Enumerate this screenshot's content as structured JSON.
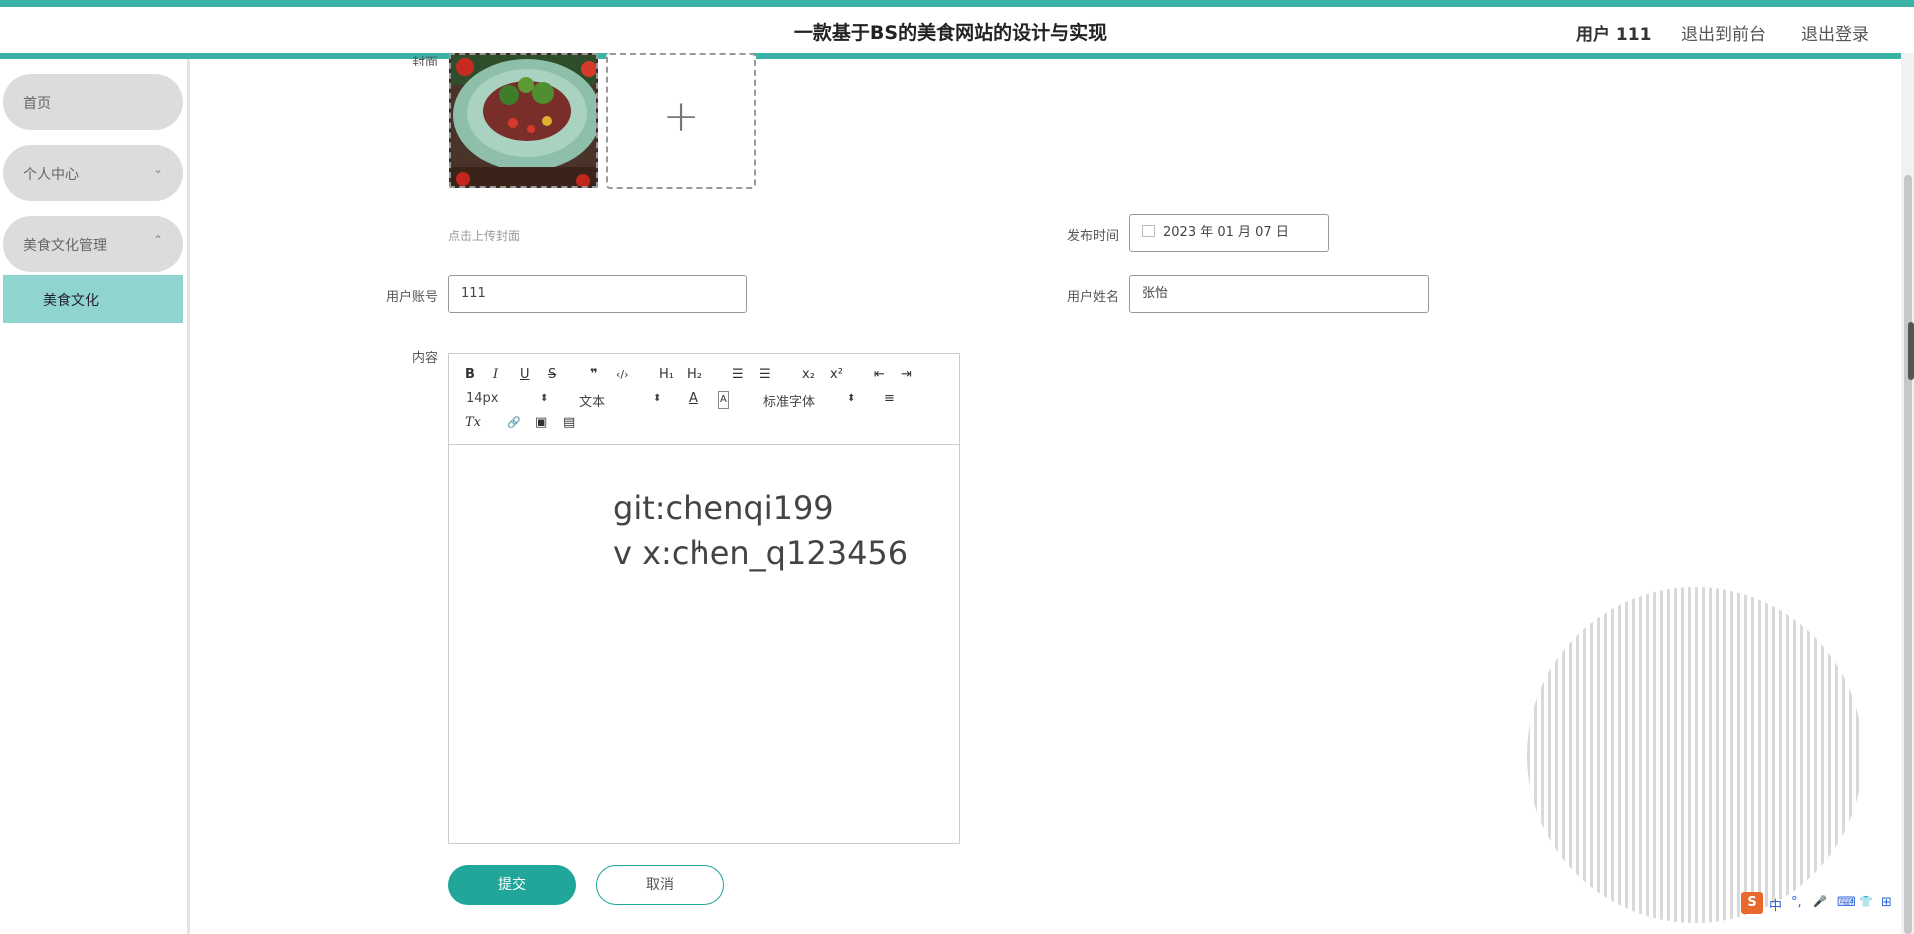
{
  "header": {
    "title": "一款基于BS的美食网站的设计与实现",
    "user": "用户 111",
    "to_front": "退出到前台",
    "logout": "退出登录"
  },
  "sidebar": {
    "items": [
      {
        "label": "首页"
      },
      {
        "label": "个人中心",
        "chevron": "⌄"
      },
      {
        "label": "美食文化管理",
        "chevron": "⌃"
      }
    ],
    "sub_item": "美食文化"
  },
  "form": {
    "cover_label": "封面",
    "cover_hint": "点击上传封面",
    "upload_plus": "+",
    "publish_time_label": "发布时间",
    "publish_time_value": "2023 年 01 月 07 日",
    "account_label": "用户账号",
    "account_value": "111",
    "name_label": "用户姓名",
    "name_value": "张怡",
    "content_label": "内容"
  },
  "editor": {
    "toolbar": {
      "bold": "B",
      "italic": "I",
      "underline": "U",
      "strike": "S",
      "quote": "❞",
      "code": "‹/›",
      "h1": "H₁",
      "h2": "H₂",
      "ordered_list": "☰",
      "bullet_list": "☰",
      "subscript": "x₂",
      "superscript": "x²",
      "outdent": "⇤",
      "indent": "⇥",
      "size": "14px",
      "header": "文本",
      "color": "A",
      "background": "A",
      "font": "标准字体",
      "align": "≡",
      "clean": "Tx",
      "link": "🔗",
      "image": "▣",
      "video": "▤",
      "select_arrow": "⬍"
    },
    "content_lines": [
      "git:chenqi199",
      "v x:chen_q123456"
    ]
  },
  "buttons": {
    "submit": "提交",
    "cancel": "取消"
  },
  "ime": {
    "logo": "S",
    "lang": "中",
    "punct": "°,",
    "mic": "🎤",
    "kbd": "⌨",
    "skin": "👕",
    "grid": "⊞"
  },
  "colors": {
    "accent": "#21a69a",
    "header_strip": "#3bb3a6",
    "sidebar_active": "#8fd4cf"
  }
}
